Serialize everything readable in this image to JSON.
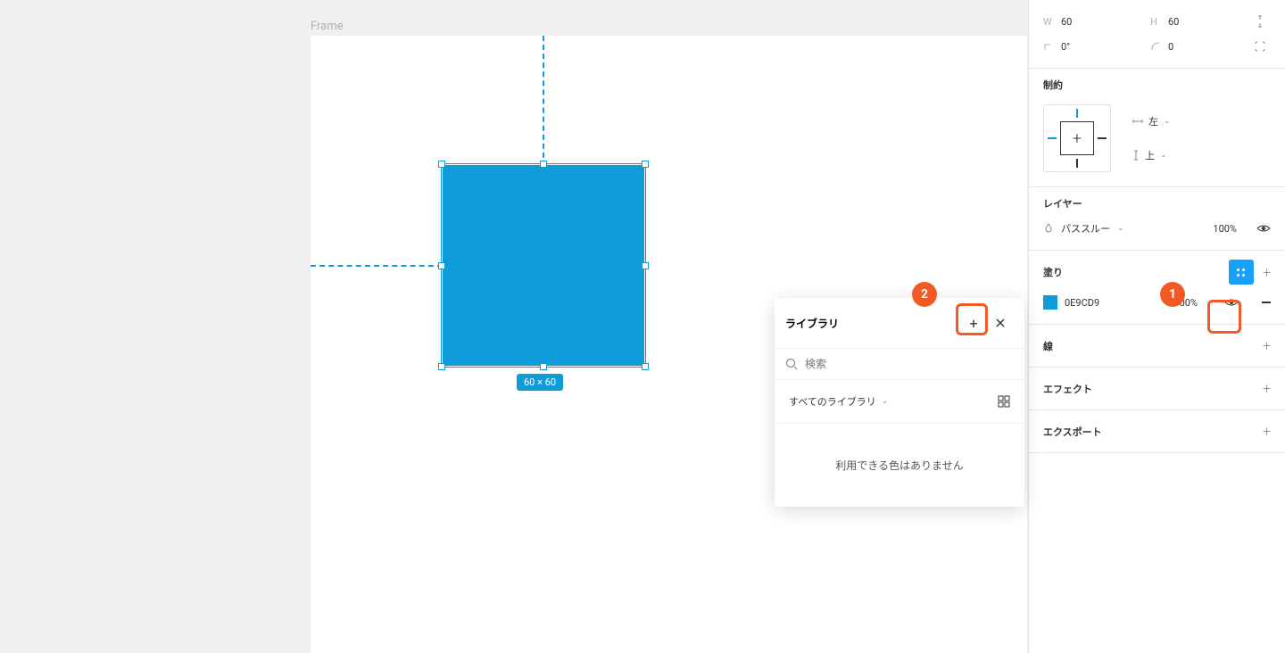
{
  "canvas": {
    "frame_label": "Frame",
    "dimensions_badge": "60 × 60"
  },
  "panel": {
    "dims": {
      "w_label": "W",
      "w_value": "60",
      "h_label": "H",
      "h_value": "60",
      "rotation_value": "0°",
      "radius_value": "0"
    },
    "constraints": {
      "title": "制約",
      "horizontal_label": "左",
      "vertical_label": "上"
    },
    "layer": {
      "title": "レイヤー",
      "blend_mode": "パススルー",
      "opacity": "100%"
    },
    "fill": {
      "title": "塗り",
      "hex": "0E9CD9",
      "opacity": "100%"
    },
    "stroke": {
      "title": "線"
    },
    "effects": {
      "title": "エフェクト"
    },
    "export": {
      "title": "エクスポート"
    }
  },
  "popup": {
    "title": "ライブラリ",
    "search_placeholder": "検索",
    "filter_label": "すべてのライブラリ",
    "empty_message": "利用できる色はありません"
  },
  "markers": {
    "one": "1",
    "two": "2"
  }
}
